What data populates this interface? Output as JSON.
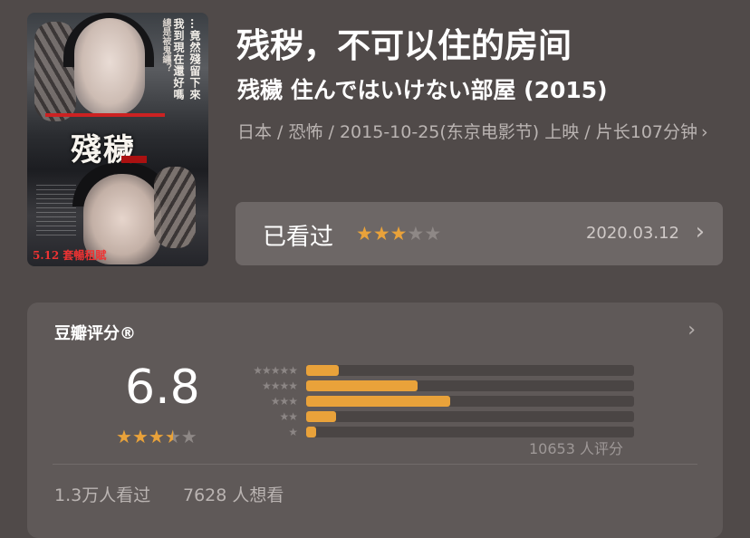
{
  "movie": {
    "title": "残秽，不可以住的房间",
    "original_title": "残穢 住んではいけない部屋 (2015)",
    "meta": "日本 / 恐怖 / 2015-10-25(东京电影节) 上映 / 片长107分钟",
    "meta_chevron": "›",
    "poster": {
      "title": "殘穢",
      "vertical_text_1": "我到現在還好嗎",
      "vertical_text_2": "…竟然殘留下來",
      "vertical_text_3": "總是被鬼纏？",
      "release": "5.12 套暢租賦"
    }
  },
  "watched": {
    "label": "已看过",
    "rating": 3,
    "max_rating": 5,
    "date": "2020.03.12",
    "chevron": "›"
  },
  "rating_panel": {
    "title": "豆瓣评分®",
    "chevron": "›",
    "score": "6.8",
    "stars_value": 3.5,
    "distribution": [
      {
        "stars": 5,
        "label": "★★★★★",
        "fraction": 0.1
      },
      {
        "stars": 4,
        "label": "★★★★",
        "fraction": 0.34
      },
      {
        "stars": 3,
        "label": "★★★",
        "fraction": 0.44
      },
      {
        "stars": 2,
        "label": "★★",
        "fraction": 0.09
      },
      {
        "stars": 1,
        "label": "★",
        "fraction": 0.03
      }
    ],
    "count_text": "10653 人评分",
    "seen_text": "1.3万人看过",
    "want_text": "7628 人想看"
  },
  "colors": {
    "background": "#504a49",
    "card": "#5f5958",
    "watched_bar": "#6d6766",
    "star_on": "#e9a23a",
    "star_off": "#8e8886"
  }
}
